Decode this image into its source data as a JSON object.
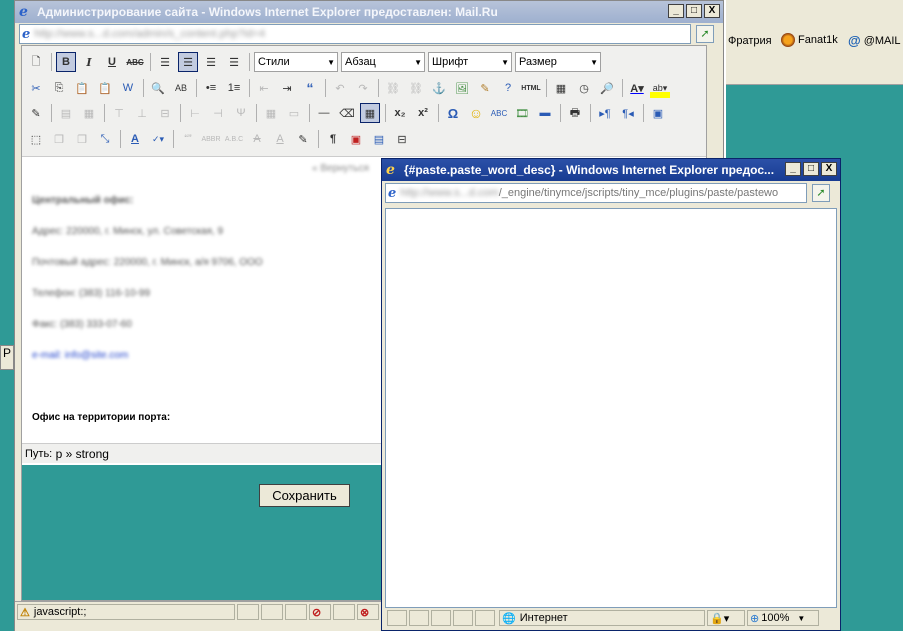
{
  "main_window": {
    "title": "Администрирование сайта - Windows Internet Explorer предоставлен: Mail.Ru",
    "address": "http://www.s...d.com/admin/s_content.php?id=4",
    "win_buttons": [
      "_",
      "□",
      "X"
    ]
  },
  "background_window": {
    "links": [
      {
        "label": "Фратрия",
        "icon": "none"
      },
      {
        "label": "Fanat1k",
        "icon": "fanat-icon"
      },
      {
        "label": "@MAIL",
        "icon": "mail-icon"
      }
    ],
    "left_fragment": "P"
  },
  "toolbar": {
    "style_select": "Стили",
    "block_select": "Абзац",
    "font_select": "Шрифт",
    "size_select": "Размер"
  },
  "content": {
    "top_link": "« Вернуться",
    "lines": [
      "Центральный офис:",
      "Адрес: 220000, г. Минск, ул. Советская, 9",
      "Почтовый адрес: 220000, г. Минск, а/я 9706, ООО",
      "Телефон: (383) 116-10-99",
      "Факс: (383) 333-07-60",
      "e-mail: info@site.com"
    ],
    "bold_line": "Офис на территории порта:"
  },
  "editor_path": {
    "label": "Путь:",
    "value": "p » strong"
  },
  "save_button": "Сохранить",
  "ie_status": {
    "text": "javascript:;"
  },
  "popup": {
    "title": "{#paste.paste_word_desc} - Windows Internet Explorer предос...",
    "address_blurred": "http://www.s...d.com",
    "address_path": "/_engine/tinymce/jscripts/tiny_mce/plugins/paste/pastewo",
    "status_zone": "Интернет",
    "zoom": "100%"
  },
  "colors": {
    "teal": "#2f9a96",
    "xp_face": "#ece9d8",
    "active_title": "#183c92"
  }
}
